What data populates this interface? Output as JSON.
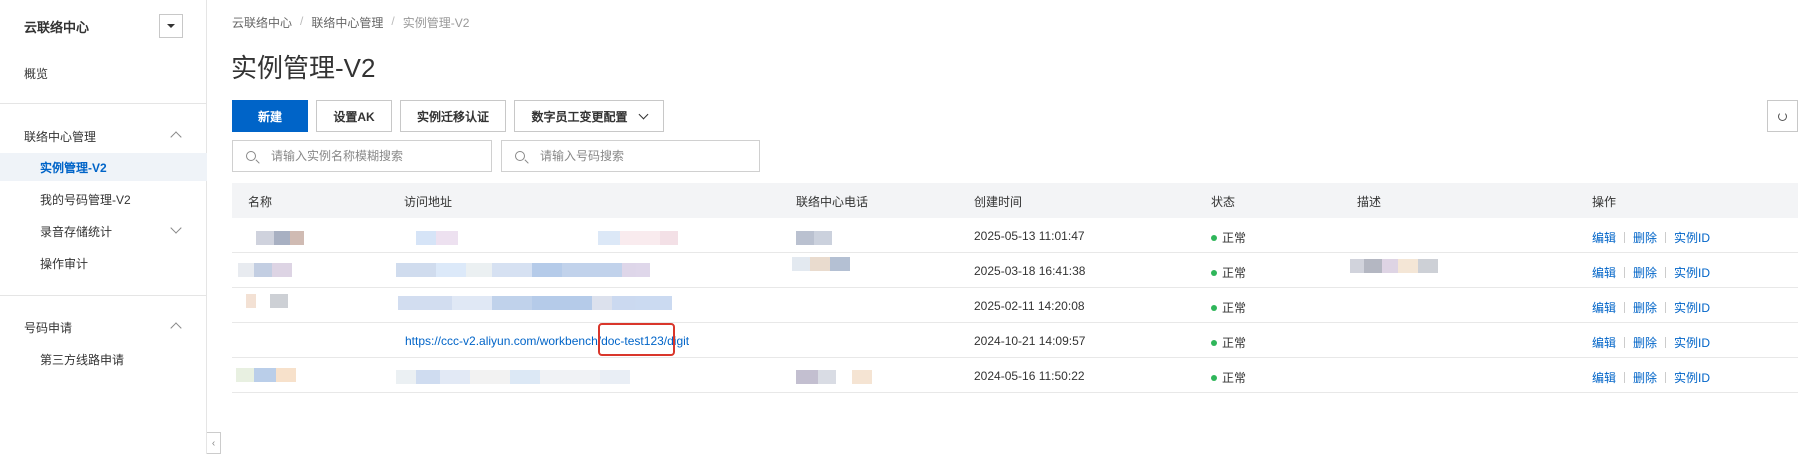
{
  "sidebar": {
    "title": "云联络中心",
    "overview": "概览",
    "groups": [
      {
        "label": "联络中心管理",
        "items": [
          "实例管理-V2",
          "我的号码管理-V2",
          "录音存储统计",
          "操作审计"
        ]
      },
      {
        "label": "号码申请",
        "items": [
          "第三方线路申请"
        ]
      }
    ],
    "active_item": "实例管理-V2"
  },
  "breadcrumb": [
    "云联络中心",
    "联络中心管理",
    "实例管理-V2"
  ],
  "page_title": "实例管理-V2",
  "toolbar": {
    "new_label": "新建",
    "set_ak_label": "设置AK",
    "migrate_label": "实例迁移认证",
    "digital_staff_label": "数字员工变更配置"
  },
  "search": {
    "instance_placeholder": "请输入实例名称模糊搜索",
    "number_placeholder": "请输入号码搜索"
  },
  "table": {
    "columns": [
      "名称",
      "访问地址",
      "联络中心电话",
      "创建时间",
      "状态",
      "描述",
      "操作"
    ],
    "rows": [
      {
        "created": "2025-05-13 11:01:47",
        "status": "正常"
      },
      {
        "created": "2025-03-18 16:41:38",
        "status": "正常"
      },
      {
        "created": "2025-02-11 14:20:08",
        "status": "正常"
      },
      {
        "created": "2024-10-21 14:09:57",
        "status": "正常",
        "url": "https://ccc-v2.aliyun.com/workbench/doc-test123/digit"
      },
      {
        "created": "2024-05-16 11:50:22",
        "status": "正常"
      }
    ],
    "ops": {
      "edit": "编辑",
      "delete": "删除",
      "instance_id": "实例ID"
    }
  },
  "colors": {
    "primary": "#0064c8",
    "status_ok": "#2fb65a",
    "highlight": "#d9362b"
  }
}
